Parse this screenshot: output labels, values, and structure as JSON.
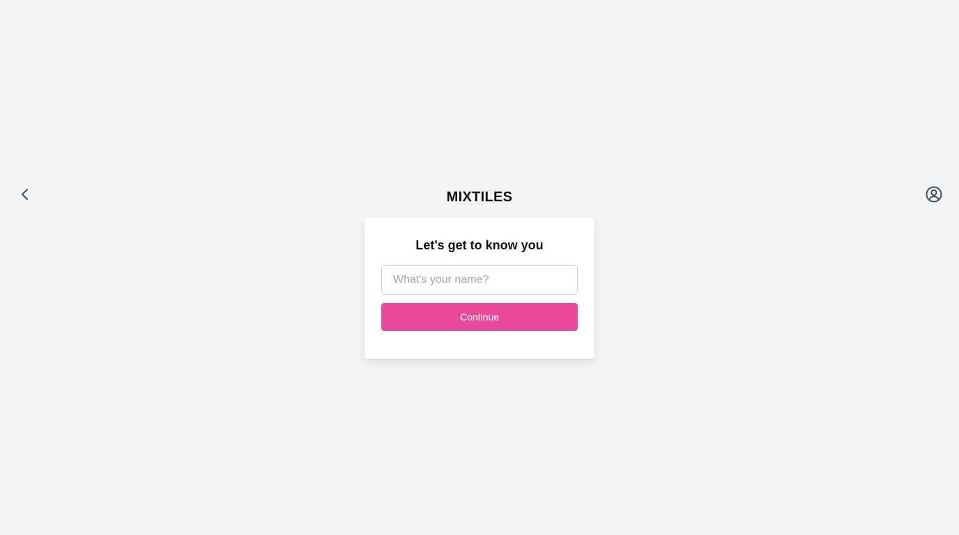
{
  "header": {
    "brand": "MIXTILES",
    "back_icon": "chevron-left-icon",
    "account_icon": "user-circle-icon"
  },
  "form": {
    "heading": "Let's get to know you",
    "name_input": {
      "value": "",
      "placeholder": "What's your name?"
    },
    "continue_label": "Continue"
  },
  "colors": {
    "page_background": "#f3f4f6",
    "card_background": "#ffffff",
    "accent": "#ea4a9c",
    "icon": "#3f4a5a"
  }
}
